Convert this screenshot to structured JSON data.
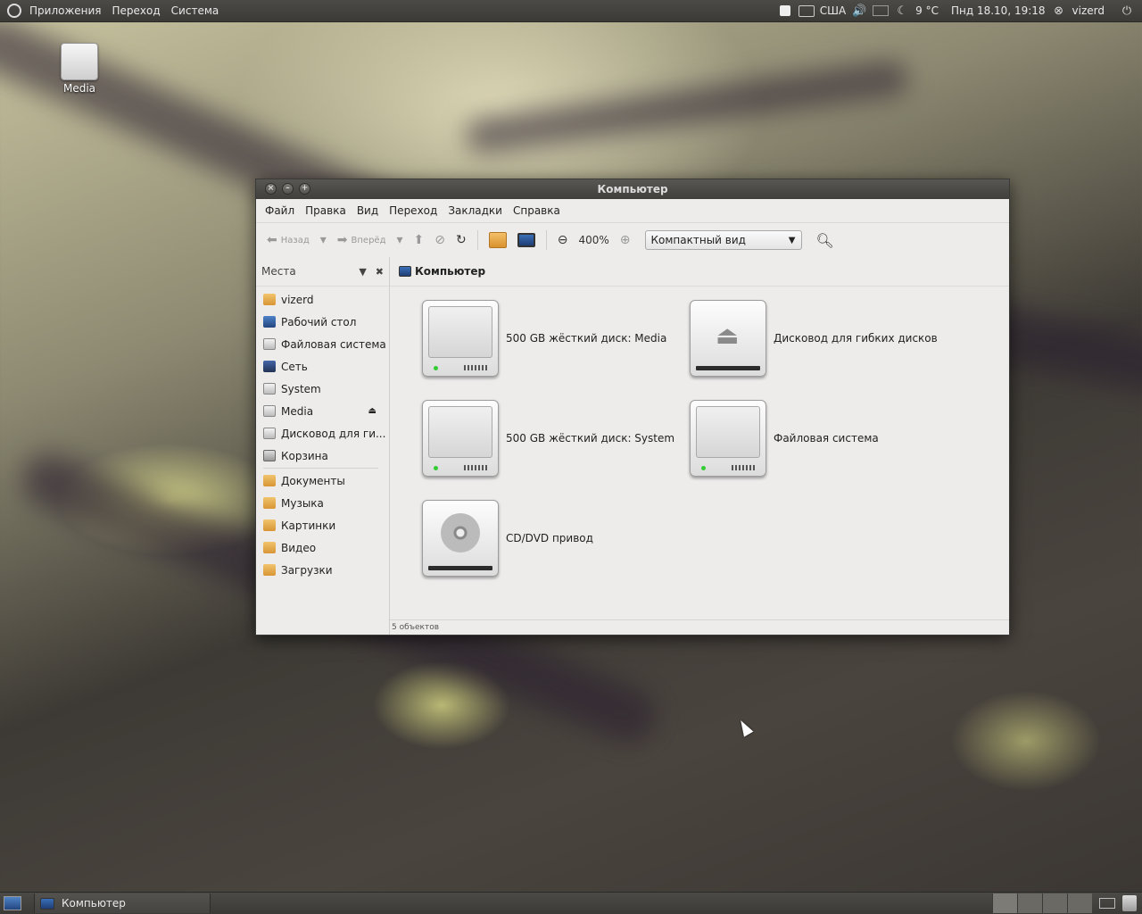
{
  "top_panel": {
    "menus": [
      "Приложения",
      "Переход",
      "Система"
    ],
    "keyboard_layout": "США",
    "weather": "9 °C",
    "clock": "Пнд 18.10, 19:18",
    "user": "vizerd"
  },
  "desktop": {
    "icons": [
      {
        "label": "Media",
        "icon": "drive-icon"
      }
    ]
  },
  "window": {
    "title": "Компьютер",
    "menu": [
      "Файл",
      "Правка",
      "Вид",
      "Переход",
      "Закладки",
      "Справка"
    ],
    "toolbar": {
      "back_label": "Назад",
      "forward_label": "Вперёд",
      "zoom": "400%",
      "view_mode": "Компактный вид"
    },
    "sidebar": {
      "title": "Места",
      "places": [
        {
          "label": "vizerd",
          "icon": "home-folder-icon"
        },
        {
          "label": "Рабочий стол",
          "icon": "desktop-icon"
        },
        {
          "label": "Файловая система",
          "icon": "drive-icon"
        },
        {
          "label": "Сеть",
          "icon": "network-icon"
        },
        {
          "label": "System",
          "icon": "drive-icon"
        },
        {
          "label": "Media",
          "icon": "drive-icon",
          "eject": true
        },
        {
          "label": "Дисковод для ги...",
          "icon": "floppy-icon"
        },
        {
          "label": "Корзина",
          "icon": "trash-icon"
        }
      ],
      "bookmarks": [
        {
          "label": "Документы",
          "icon": "folder-icon"
        },
        {
          "label": "Музыка",
          "icon": "folder-icon"
        },
        {
          "label": "Картинки",
          "icon": "folder-icon"
        },
        {
          "label": "Видео",
          "icon": "folder-icon"
        },
        {
          "label": "Загрузки",
          "icon": "folder-icon"
        }
      ]
    },
    "location": "Компьютер",
    "items": [
      {
        "label": "500 GB жёсткий диск: Media",
        "icon": "hard-drive-icon"
      },
      {
        "label": "Дисковод для гибких дисков",
        "icon": "floppy-drive-icon"
      },
      {
        "label": "500 GB жёсткий диск: System",
        "icon": "hard-drive-icon"
      },
      {
        "label": "Файловая система",
        "icon": "hard-drive-icon"
      },
      {
        "label": "CD/DVD привод",
        "icon": "optical-drive-icon"
      }
    ],
    "status": "5 объектов"
  },
  "taskbar": {
    "tasks": [
      {
        "label": "Компьютер",
        "icon": "computer-icon"
      }
    ]
  }
}
